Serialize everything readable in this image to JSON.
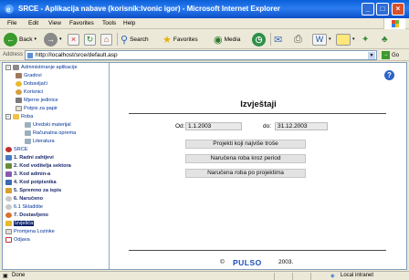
{
  "window": {
    "title": "SRCE - Aplikacija nabave (korisnik:lvonic igor) - Microsoft Internet Explorer"
  },
  "menu": [
    "File",
    "Edit",
    "View",
    "Favorites",
    "Tools",
    "Help"
  ],
  "toolbar": {
    "back": "Back",
    "search": "Search",
    "favorites": "Favorites",
    "media": "Media"
  },
  "address": {
    "label": "Address",
    "url": "http://localhost/srce/default.asp",
    "go": "Go"
  },
  "tree": {
    "admin": "Administriranje aplikacije",
    "gradovi": "Gradovi",
    "dobavljaci": "Dobavljači",
    "korisnici": "Korisnici",
    "mjerne": "Mjerne jedinice",
    "potpis": "Potpis za papir",
    "roba": "Roba",
    "uredski": "Uredski materijal",
    "racunalna": "Računalna oprema",
    "literatura": "Literatura",
    "srce": "SRCE",
    "radni": "1. Radni zahtjevi",
    "voditelja": "2. Kod voditelja sektora",
    "admina": "3. Kod admin-a",
    "potpisnika": "4. Kod potpisnika",
    "spremno": "5. Spremno za ispis",
    "naruceno": "6. Naručeno",
    "skladiste": "6.1 Skladište",
    "dostavljeno": "7. Dostavljeno",
    "izvjesca": "Izvješća",
    "lozinka": "Promjena Lozinke",
    "odjava": "Odjava"
  },
  "main": {
    "heading": "Izvještaji",
    "od_label": "Od:",
    "od_value": "1.1.2003",
    "do_label": "do:",
    "do_value": "31.12.2003",
    "btn1": "Projekti koji najviše troše",
    "btn2": "Naručena roba kroz period",
    "btn3": "Naručena roba po projektima",
    "copyright": "©",
    "brand": "PULSO",
    "year": "2003."
  },
  "status": {
    "left": "Done",
    "right": "Local intranet"
  },
  "colors": {
    "titlebar": "#0a5fd8",
    "brand": "#1a4fb4",
    "selected": "#0a246a"
  }
}
